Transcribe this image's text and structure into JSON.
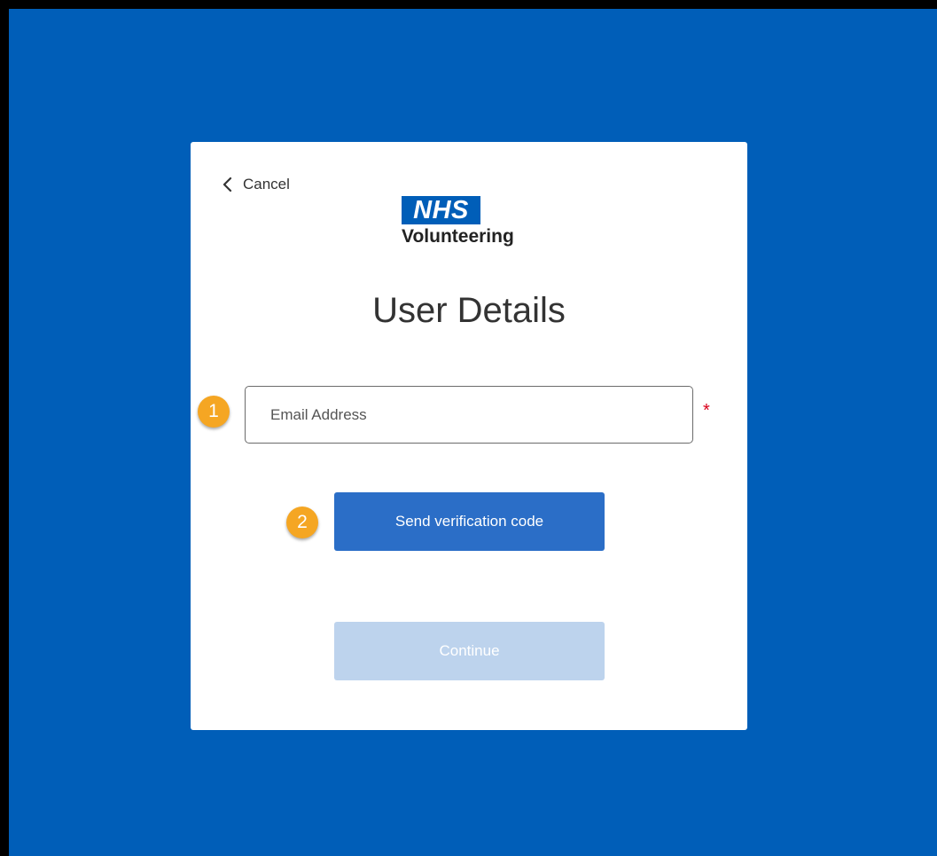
{
  "cancel": {
    "label": "Cancel",
    "icon": "chevron-left-icon"
  },
  "logo": {
    "mark": "NHS",
    "subtitle": "Volunteering"
  },
  "page": {
    "title": "User Details"
  },
  "form": {
    "email": {
      "placeholder": "Email Address",
      "value": "",
      "required_marker": "*"
    },
    "send_code_label": "Send verification code",
    "continue_label": "Continue",
    "continue_disabled": true
  },
  "annotations": {
    "step1": "1",
    "step2": "2"
  },
  "colors": {
    "background": "#005eb8",
    "primary_button": "#2b6ec7",
    "disabled_button": "#bdd3ed",
    "badge": "#f5a623",
    "required": "#d9001b"
  }
}
